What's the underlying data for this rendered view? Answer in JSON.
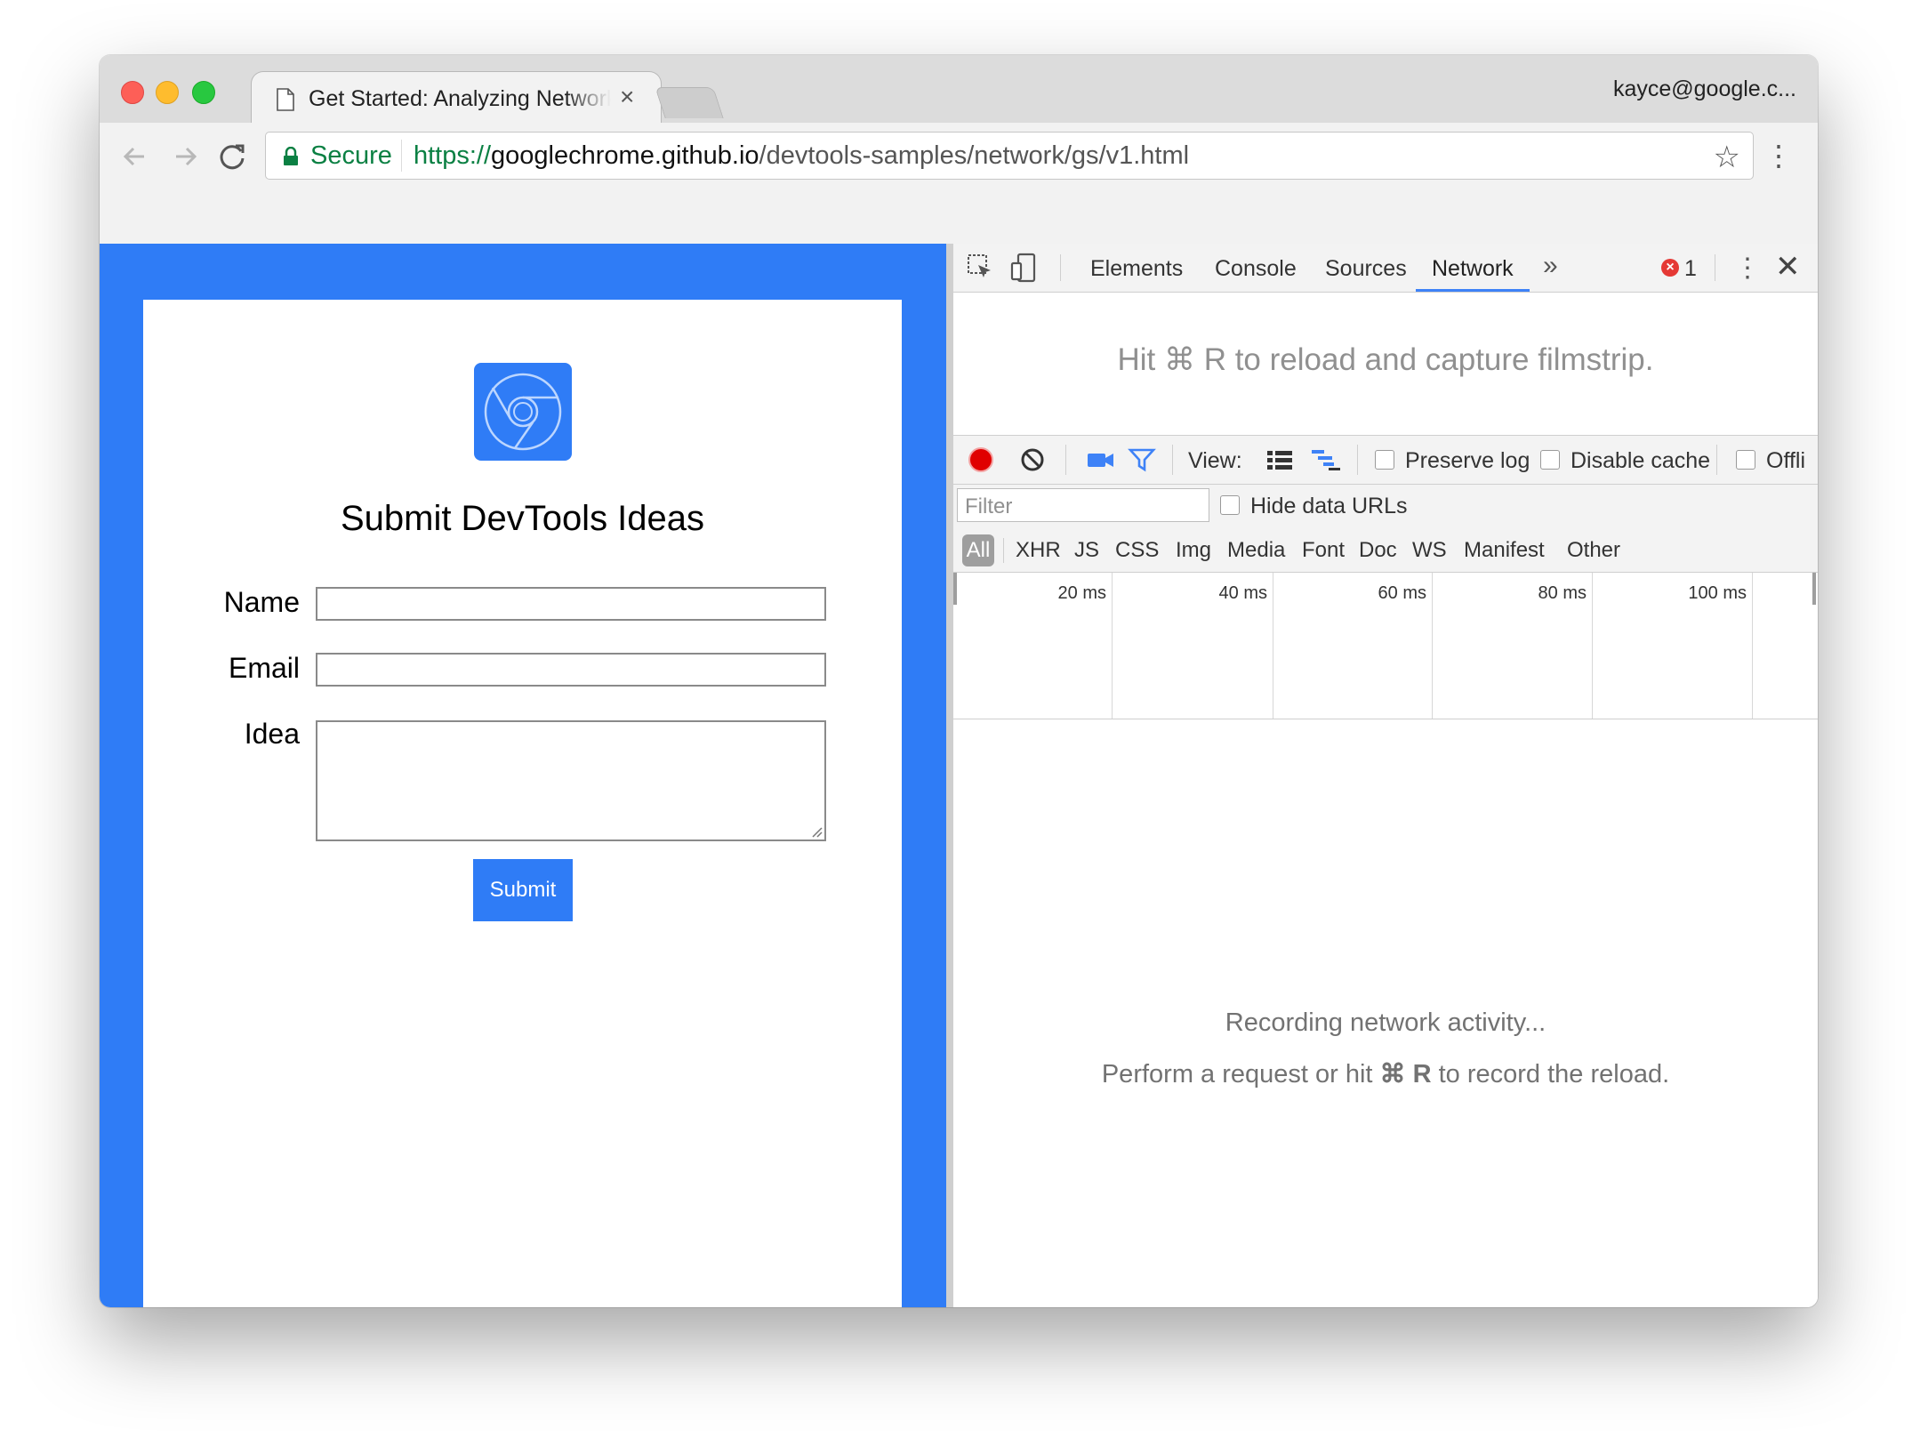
{
  "browser": {
    "tab_title": "Get Started: Analyzing Network",
    "tab_close": "×",
    "profile": "kayce@google.c...",
    "security_label": "Secure",
    "url_scheme": "https://",
    "url_host": "googlechrome.github.io",
    "url_path": "/devtools-samples/network/gs/v1.html",
    "bookmark_icon": "star-icon",
    "menu_icon": "⋮"
  },
  "page": {
    "title": "Submit DevTools Ideas",
    "name_label": "Name",
    "email_label": "Email",
    "idea_label": "Idea",
    "name_value": "",
    "email_value": "",
    "idea_value": "",
    "submit_label": "Submit",
    "background_color": "#2f7cf6"
  },
  "devtools": {
    "tabs": [
      "Elements",
      "Console",
      "Sources",
      "Network"
    ],
    "active_tab": "Network",
    "more_tabs": "»",
    "error_count": "1",
    "kebab": "⋮",
    "close": "✕",
    "filmstrip_message": "Hit ⌘ R to reload and capture filmstrip.",
    "view_label": "View:",
    "preserve_log_label": "Preserve log",
    "preserve_log_checked": false,
    "disable_cache_label": "Disable cache",
    "disable_cache_checked": false,
    "offline_label": "Offli",
    "offline_checked": false,
    "filter_placeholder": "Filter",
    "hide_data_urls_label": "Hide data URLs",
    "hide_data_urls_checked": false,
    "resource_types": [
      "All",
      "XHR",
      "JS",
      "CSS",
      "Img",
      "Media",
      "Font",
      "Doc",
      "WS",
      "Manifest",
      "Other"
    ],
    "active_type": "All",
    "timeline_ticks": [
      "20 ms",
      "40 ms",
      "60 ms",
      "80 ms",
      "100 ms"
    ],
    "empty_line1": "Recording network activity...",
    "empty_line2_prefix": "Perform a request or hit ",
    "empty_line2_keys": "⌘ R",
    "empty_line2_suffix": " to record the reload.",
    "record_color": "#e00000",
    "accent_color": "#3e82f7"
  }
}
